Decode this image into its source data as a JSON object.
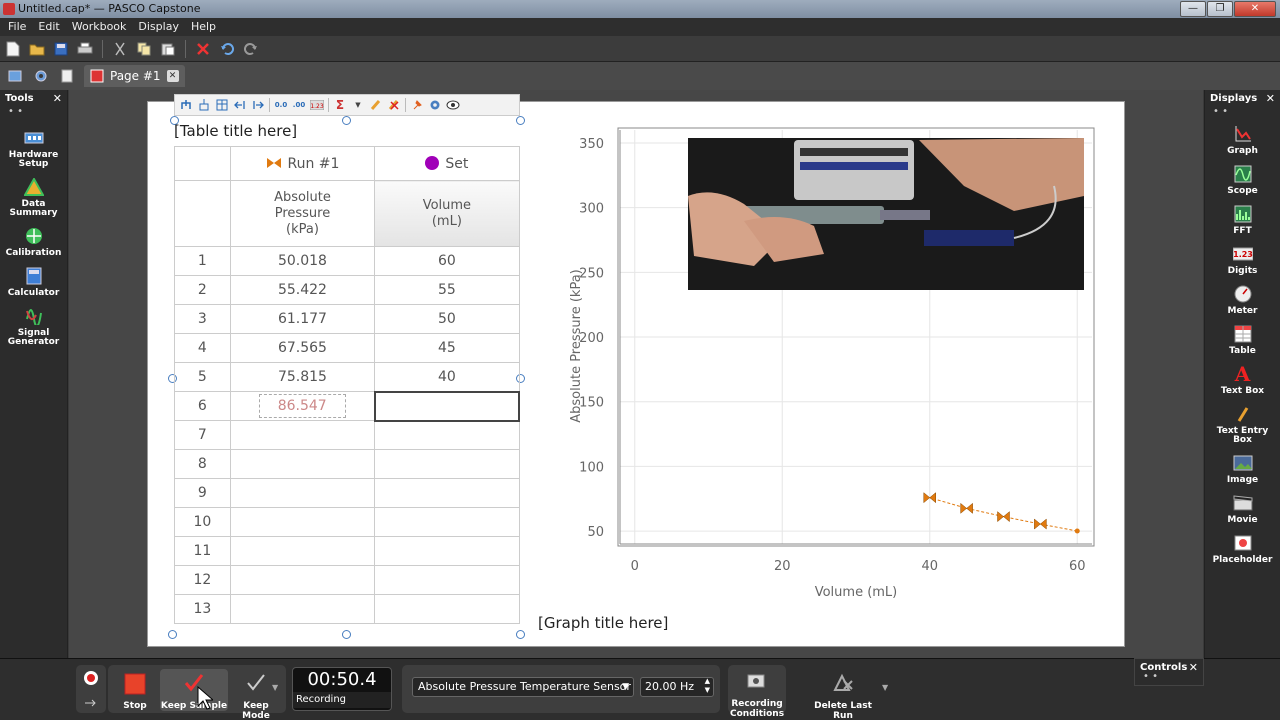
{
  "window": {
    "title": "Untitled.cap* — PASCO Capstone",
    "min": "—",
    "max": "❐",
    "close": "✕"
  },
  "menu": [
    "File",
    "Edit",
    "Workbook",
    "Display",
    "Help"
  ],
  "tab": {
    "label": "Page #1",
    "close": "✕"
  },
  "tools": {
    "title": "Tools",
    "close": "✕",
    "dots": "• •",
    "items": [
      {
        "label1": "Hardware",
        "label2": "Setup",
        "icon": "hardware-icon",
        "color": "#4a8fd6"
      },
      {
        "label1": "Data",
        "label2": "Summary",
        "icon": "data-summary-icon",
        "color": "#e8b030"
      },
      {
        "label1": "Calibration",
        "label2": "",
        "icon": "calibration-icon",
        "color": "#3fbf5a"
      },
      {
        "label1": "Calculator",
        "label2": "",
        "icon": "calculator-icon",
        "color": "#3f7fd6"
      },
      {
        "label1": "Signal",
        "label2": "Generator",
        "icon": "signal-generator-icon",
        "color": "#d04040"
      }
    ]
  },
  "displays": {
    "title": "Displays",
    "close": "✕",
    "dots": "• •",
    "items": [
      {
        "label1": "Graph",
        "label2": ""
      },
      {
        "label1": "Scope",
        "label2": ""
      },
      {
        "label1": "FFT",
        "label2": ""
      },
      {
        "label1": "Digits",
        "label2": ""
      },
      {
        "label1": "Meter",
        "label2": ""
      },
      {
        "label1": "Table",
        "label2": ""
      },
      {
        "label1": "Text Box",
        "label2": ""
      },
      {
        "label1": "Text Entry",
        "label2": "Box"
      },
      {
        "label1": "Image",
        "label2": ""
      },
      {
        "label1": "Movie",
        "label2": ""
      },
      {
        "label1": "Placeholder",
        "label2": ""
      }
    ]
  },
  "table": {
    "title": "[Table title here]",
    "run_label": "Run #1",
    "set_label": "Set",
    "col_a_header": [
      "Absolute",
      "Pressure",
      "(kPa)"
    ],
    "col_b_header": [
      "Volume",
      "(mL)"
    ],
    "rows": [
      {
        "n": "1",
        "a": "50.018",
        "b": "60"
      },
      {
        "n": "2",
        "a": "55.422",
        "b": "55"
      },
      {
        "n": "3",
        "a": "61.177",
        "b": "50"
      },
      {
        "n": "4",
        "a": "67.565",
        "b": "45"
      },
      {
        "n": "5",
        "a": "75.815",
        "b": "40"
      },
      {
        "n": "6",
        "a": "86.547",
        "b": ""
      },
      {
        "n": "7",
        "a": "",
        "b": ""
      },
      {
        "n": "8",
        "a": "",
        "b": ""
      },
      {
        "n": "9",
        "a": "",
        "b": ""
      },
      {
        "n": "10",
        "a": "",
        "b": ""
      },
      {
        "n": "11",
        "a": "",
        "b": ""
      },
      {
        "n": "12",
        "a": "",
        "b": ""
      },
      {
        "n": "13",
        "a": "",
        "b": ""
      }
    ]
  },
  "graph": {
    "title": "[Graph title here]"
  },
  "chart_data": {
    "type": "scatter",
    "xlabel": "Volume (mL)",
    "ylabel": "Absolute Pressure (kPa)",
    "xlim": [
      -2,
      62
    ],
    "ylim": [
      40,
      360
    ],
    "xticks": [
      0,
      20,
      40,
      60
    ],
    "yticks": [
      50,
      100,
      150,
      200,
      250,
      300,
      350
    ],
    "grid": true,
    "series": [
      {
        "x": [
          60,
          55,
          50,
          45,
          40
        ],
        "y": [
          50.018,
          55.422,
          61.177,
          67.565,
          75.815
        ],
        "color": "#e07a10"
      }
    ]
  },
  "controls": {
    "stop": "Stop",
    "keep_sample": "Keep Sample",
    "keep_mode": "Keep Mode",
    "timer": "00:50.4",
    "status": "Recording",
    "sensor": "Absolute Pressure Temperature Sensor",
    "rate": "20.00 Hz",
    "recording_conditions_1": "Recording",
    "recording_conditions_2": "Conditions",
    "delete_last_run": "Delete Last Run",
    "panel_title": "Controls",
    "panel_close": "✕",
    "panel_dots": "• •"
  }
}
